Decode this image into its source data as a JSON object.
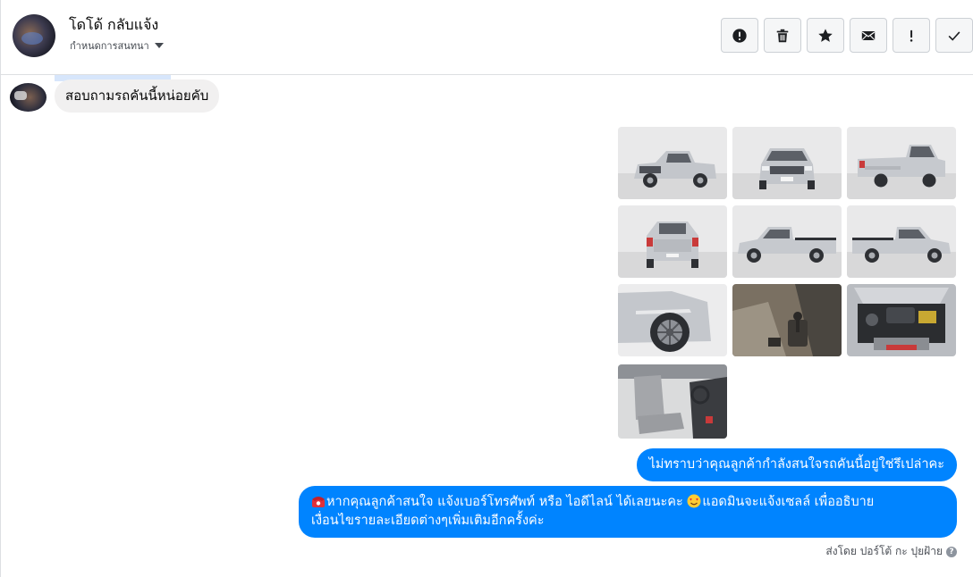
{
  "header": {
    "contact_name": "โดโด้ กลับแจ้ง",
    "conversation_settings": "กำหนดการสนทนา"
  },
  "actions": [
    {
      "name": "report",
      "glyph": "exclamation-circle-icon"
    },
    {
      "name": "delete",
      "glyph": "trash-icon"
    },
    {
      "name": "star",
      "glyph": "star-icon"
    },
    {
      "name": "mark-unread",
      "glyph": "envelope-icon"
    },
    {
      "name": "spam",
      "glyph": "exclamation-icon"
    },
    {
      "name": "done",
      "glyph": "check-icon"
    }
  ],
  "messages": {
    "incoming": "สอบถามรถคันนี้หน่อยคับ",
    "outgoing_1": "ไม่ทราบว่าคุณลูกค้ากำลังสนใจรถคันนี้อยู่ใช่รึเปล่าคะ",
    "outgoing_2_line1": "หากคุณลูกค้าสนใจ แจ้งเบอร์โทรศัพท์ หรือ ไอดีไลน์  ได้เลยนะคะ ",
    "outgoing_2_line1b": "แอดมินจะแจ้งเซลล์   เพื่ออธิบาย",
    "outgoing_2_line2": "เงื่อนไขรายละเอียดต่างๆเพิ่มเติมอีกครั้งค่ะ",
    "sent_by": "ส่งโดย ปอร์โต้ กะ ปุยฝ้าย"
  },
  "photos": [
    {
      "name": "front-three-quarter",
      "view": "front-angle"
    },
    {
      "name": "front",
      "view": "front"
    },
    {
      "name": "rear-three-quarter",
      "view": "rear-angle"
    },
    {
      "name": "rear",
      "view": "rear"
    },
    {
      "name": "side-left",
      "view": "side"
    },
    {
      "name": "side-right",
      "view": "side"
    },
    {
      "name": "wheel-closeup",
      "view": "wheel"
    },
    {
      "name": "interior-gearshift",
      "view": "interior"
    },
    {
      "name": "engine-bay",
      "view": "engine"
    },
    {
      "name": "interior-seats",
      "view": "seats"
    }
  ],
  "colors": {
    "outgoing_bubble": "#0084ff",
    "incoming_bubble": "#f1f0f0",
    "car_silver": "#c9ccd1"
  }
}
